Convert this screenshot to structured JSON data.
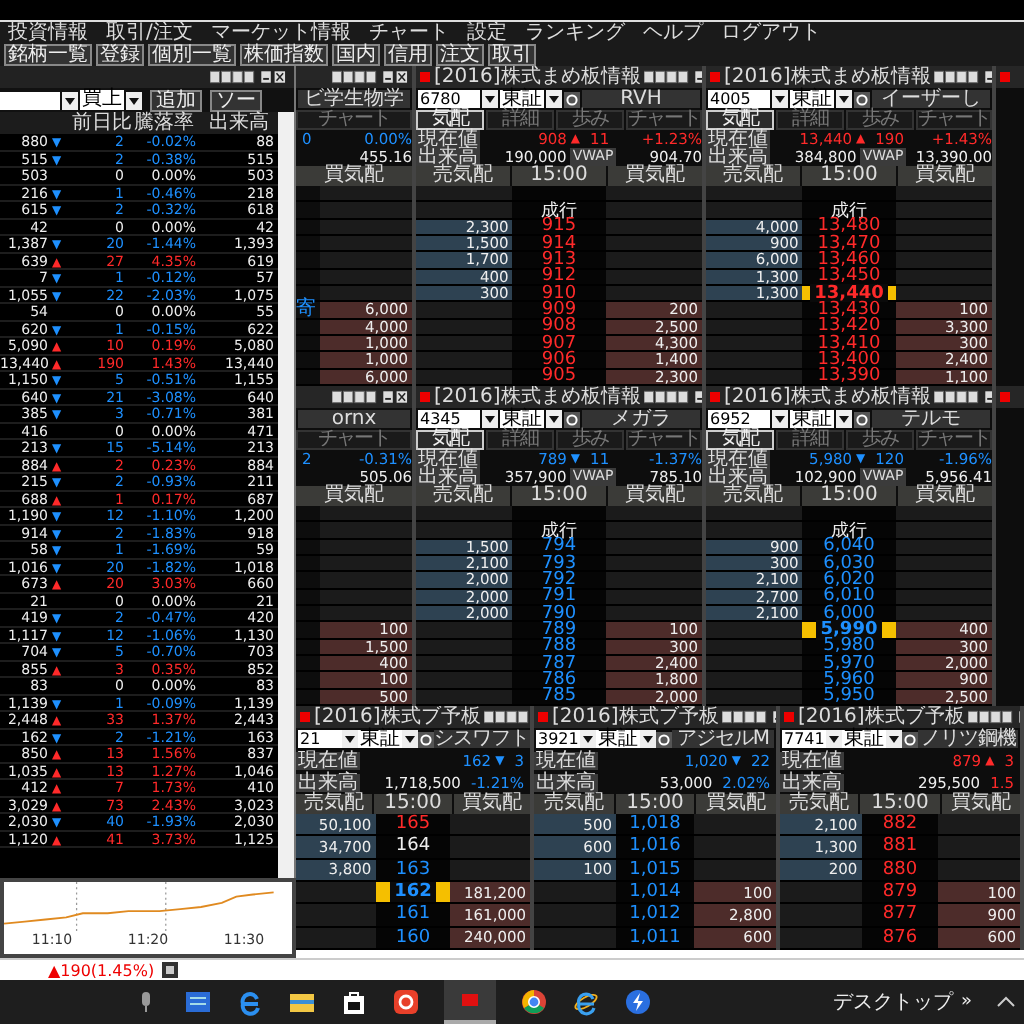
{
  "menu": [
    "投資情報",
    "取引/注文",
    "マーケット情報",
    "チャート",
    "設定",
    "ランキング",
    "ヘルプ",
    "ログアウト"
  ],
  "toolbar": [
    "銘柄一覧",
    "登録",
    "個別一覧",
    "株価指数",
    "国内",
    "信用",
    "注文",
    "取引"
  ],
  "list": {
    "market": "買上",
    "add_button": "追加",
    "sort_button": "ソー",
    "columns": [
      "前日比",
      "騰落率",
      "出来高"
    ],
    "rows": [
      {
        "price": "880",
        "color": "#1e90ff",
        "arrow": "▼",
        "change": "2",
        "pct": "-0.02%",
        "volume": "88"
      },
      {
        "price": "515",
        "color": "#1e90ff",
        "arrow": "▼",
        "change": "2",
        "pct": "-0.38%",
        "volume": "515"
      },
      {
        "price": "503",
        "color": "#eeeeee",
        "change": "0",
        "pct": "0.00%",
        "volume": "503"
      },
      {
        "price": "216",
        "color": "#1e90ff",
        "arrow": "▼",
        "change": "1",
        "pct": "-0.46%",
        "volume": "218"
      },
      {
        "price": "615",
        "color": "#1e90ff",
        "arrow": "▼",
        "change": "2",
        "pct": "-0.32%",
        "volume": "618"
      },
      {
        "price": "42",
        "color": "#eeeeee",
        "change": "0",
        "pct": "0.00%",
        "volume": "42"
      },
      {
        "price": "1,387",
        "color": "#1e90ff",
        "arrow": "▼",
        "change": "20",
        "pct": "-1.44%",
        "volume": "1,393"
      },
      {
        "price": "639",
        "color": "#ff2a2a",
        "arrow": "▲",
        "change": "27",
        "pct": "4.35%",
        "volume": "619"
      },
      {
        "price": "7",
        "color": "#1e90ff",
        "arrow": "▼",
        "change": "1",
        "pct": "-0.12%",
        "volume": "57"
      },
      {
        "price": "1,055",
        "color": "#1e90ff",
        "arrow": "▼",
        "change": "22",
        "pct": "-2.03%",
        "volume": "1,075"
      },
      {
        "price": "54",
        "color": "#eeeeee",
        "change": "0",
        "pct": "0.00%",
        "volume": "55"
      },
      {
        "price": "620",
        "color": "#1e90ff",
        "arrow": "▼",
        "change": "1",
        "pct": "-0.15%",
        "volume": "622"
      },
      {
        "price": "5,090",
        "color": "#ff2a2a",
        "arrow": "▲",
        "change": "10",
        "pct": "0.19%",
        "volume": "5,080"
      },
      {
        "price": "13,440",
        "color": "#ff2a2a",
        "arrow": "▲",
        "change": "190",
        "pct": "1.43%",
        "volume": "13,440"
      },
      {
        "price": "1,150",
        "color": "#1e90ff",
        "arrow": "▼",
        "change": "5",
        "pct": "-0.51%",
        "volume": "1,155"
      },
      {
        "price": "640",
        "color": "#1e90ff",
        "arrow": "▼",
        "change": "21",
        "pct": "-3.08%",
        "volume": "640"
      },
      {
        "price": "385",
        "color": "#1e90ff",
        "arrow": "▼",
        "change": "3",
        "pct": "-0.71%",
        "volume": "381"
      },
      {
        "price": "416",
        "color": "#eeeeee",
        "change": "0",
        "pct": "0.00%",
        "volume": "471"
      },
      {
        "price": "213",
        "color": "#1e90ff",
        "arrow": "▼",
        "change": "15",
        "pct": "-5.14%",
        "volume": "213"
      },
      {
        "price": "884",
        "color": "#ff2a2a",
        "arrow": "▲",
        "change": "2",
        "pct": "0.23%",
        "volume": "884"
      },
      {
        "price": "215",
        "color": "#1e90ff",
        "arrow": "▼",
        "change": "2",
        "pct": "-0.93%",
        "volume": "211"
      },
      {
        "price": "688",
        "color": "#ff2a2a",
        "arrow": "▲",
        "change": "1",
        "pct": "0.17%",
        "volume": "687"
      },
      {
        "price": "1,190",
        "color": "#1e90ff",
        "arrow": "▼",
        "change": "12",
        "pct": "-1.10%",
        "volume": "1,200"
      },
      {
        "price": "914",
        "color": "#1e90ff",
        "arrow": "▼",
        "change": "2",
        "pct": "-1.83%",
        "volume": "918"
      },
      {
        "price": "58",
        "color": "#1e90ff",
        "arrow": "▼",
        "change": "1",
        "pct": "-1.69%",
        "volume": "59"
      },
      {
        "price": "1,016",
        "color": "#1e90ff",
        "arrow": "▼",
        "change": "20",
        "pct": "-1.82%",
        "volume": "1,018"
      },
      {
        "price": "673",
        "color": "#ff2a2a",
        "arrow": "▲",
        "change": "20",
        "pct": "3.03%",
        "volume": "660"
      },
      {
        "price": "21",
        "color": "#eeeeee",
        "change": "0",
        "pct": "0.00%",
        "volume": "21"
      },
      {
        "price": "419",
        "color": "#1e90ff",
        "arrow": "▼",
        "change": "2",
        "pct": "-0.47%",
        "volume": "420"
      },
      {
        "price": "1,117",
        "color": "#1e90ff",
        "arrow": "▼",
        "change": "12",
        "pct": "-1.06%",
        "volume": "1,130"
      },
      {
        "price": "704",
        "color": "#1e90ff",
        "arrow": "▼",
        "change": "5",
        "pct": "-0.70%",
        "volume": "703"
      },
      {
        "price": "855",
        "color": "#ff2a2a",
        "arrow": "▲",
        "change": "3",
        "pct": "0.35%",
        "volume": "852"
      },
      {
        "price": "83",
        "color": "#eeeeee",
        "change": "0",
        "pct": "0.00%",
        "volume": "83"
      },
      {
        "price": "1,139",
        "color": "#1e90ff",
        "arrow": "▼",
        "change": "1",
        "pct": "-0.09%",
        "volume": "1,139"
      },
      {
        "price": "2,448",
        "color": "#ff2a2a",
        "arrow": "▲",
        "change": "33",
        "pct": "1.37%",
        "volume": "2,443"
      },
      {
        "price": "162",
        "color": "#1e90ff",
        "arrow": "▼",
        "change": "2",
        "pct": "-1.21%",
        "volume": "163"
      },
      {
        "price": "850",
        "color": "#ff2a2a",
        "arrow": "▲",
        "change": "13",
        "pct": "1.56%",
        "volume": "837"
      },
      {
        "price": "1,035",
        "color": "#ff2a2a",
        "arrow": "▲",
        "change": "13",
        "pct": "1.27%",
        "volume": "1,046"
      },
      {
        "price": "412",
        "color": "#ff2a2a",
        "arrow": "▲",
        "change": "7",
        "pct": "1.73%",
        "volume": "410"
      },
      {
        "price": "3,029",
        "color": "#ff2a2a",
        "arrow": "▲",
        "change": "73",
        "pct": "2.43%",
        "volume": "3,023"
      },
      {
        "price": "2,030",
        "color": "#1e90ff",
        "arrow": "▼",
        "change": "40",
        "pct": "-1.93%",
        "volume": "2,030"
      },
      {
        "price": "1,120",
        "color": "#ff2a2a",
        "arrow": "▲",
        "change": "41",
        "pct": "3.73%",
        "volume": "1,125"
      }
    ]
  },
  "chart": {
    "xlabels": [
      "11:10",
      "11:20",
      "11:30"
    ]
  },
  "board_rows": [
    [
      {
        "kind": "buy-only",
        "name": "ビ学生物学",
        "tab": "チャート",
        "change": "0",
        "pct": "0.00%",
        "vwap": "455.16",
        "buy_header": "買気配",
        "ladder": [
          {
            "buy": "6,000",
            "tag": "寄"
          },
          {
            "buy": "4,000"
          },
          {
            "buy": "1,000"
          },
          {
            "buy": "1,000"
          },
          {
            "buy": "6,000"
          }
        ]
      },
      {
        "kind": "full",
        "title": "[2016]株式まめ板情報",
        "code": "6780",
        "market": "東証",
        "name": "RVH",
        "tabs": [
          {
            "label": "気配",
            "selected": true
          },
          {
            "label": "詳細",
            "selected": false
          },
          {
            "label": "歩み",
            "selected": false
          },
          {
            "label": "チャート",
            "selected": false
          }
        ],
        "price_label": "現在値",
        "price": "908",
        "color": "#ff2a2a",
        "arrow": "▲",
        "change": "11",
        "pct": "+1.23%",
        "volume_label": "出来高",
        "volume": "190,000",
        "vwap_label": "VWAP",
        "vwap": "904.70",
        "headers": [
          "売気配",
          "15:00",
          "買気配"
        ],
        "ladder": [
          {
            "current": false
          },
          {
            "price": "成行",
            "color": "#eeeeee",
            "current": false
          },
          {
            "sell": "2,300",
            "price": "915",
            "color": "#ff2a2a",
            "current": false
          },
          {
            "sell": "1,500",
            "price": "914",
            "color": "#ff2a2a",
            "current": false
          },
          {
            "sell": "1,700",
            "price": "913",
            "color": "#ff2a2a",
            "current": false
          },
          {
            "sell": "400",
            "price": "912",
            "color": "#ff2a2a",
            "current": false
          },
          {
            "sell": "300",
            "price": "910",
            "color": "#ff2a2a",
            "current": false
          },
          {
            "price": "909",
            "buy": "200",
            "color": "#ff2a2a",
            "current": false
          },
          {
            "price": "908",
            "buy": "2,500",
            "color": "#ff2a2a",
            "current": false
          },
          {
            "price": "907",
            "buy": "4,300",
            "color": "#ff2a2a",
            "current": false
          },
          {
            "price": "906",
            "buy": "1,400",
            "color": "#ff2a2a",
            "current": false
          },
          {
            "price": "905",
            "buy": "2,300",
            "color": "#ff2a2a",
            "current": false
          }
        ]
      },
      {
        "kind": "full",
        "title": "[2016]株式まめ板情報",
        "code": "4005",
        "market": "東証",
        "name": "イーザーし",
        "tabs": [
          {
            "label": "気配",
            "selected": true
          },
          {
            "label": "詳細",
            "selected": false
          },
          {
            "label": "歩み",
            "selected": false
          },
          {
            "label": "チャート",
            "selected": false
          }
        ],
        "price_label": "現在値",
        "price": "13,440",
        "color": "#ff2a2a",
        "arrow": "▲",
        "change": "190",
        "pct": "+1.43%",
        "volume_label": "出来高",
        "volume": "384,800",
        "vwap_label": "VWAP",
        "vwap": "13,390.00",
        "headers": [
          "売気配",
          "15:00",
          "買気配"
        ],
        "ladder": [
          {
            "current": false
          },
          {
            "price": "成行",
            "color": "#eeeeee",
            "current": false
          },
          {
            "sell": "4,000",
            "price": "13,480",
            "color": "#ff2a2a",
            "current": false
          },
          {
            "sell": "900",
            "price": "13,470",
            "color": "#ff2a2a",
            "current": false
          },
          {
            "sell": "6,000",
            "price": "13,460",
            "color": "#ff2a2a",
            "current": false
          },
          {
            "sell": "1,300",
            "price": "13,450",
            "color": "#ff2a2a",
            "current": false
          },
          {
            "sell": "1,300",
            "price": "13,440",
            "color": "#ff2a2a",
            "current": true
          },
          {
            "price": "13,430",
            "buy": "100",
            "color": "#ff2a2a",
            "current": false
          },
          {
            "price": "13,420",
            "buy": "3,300",
            "color": "#ff2a2a",
            "current": false
          },
          {
            "price": "13,410",
            "buy": "300",
            "color": "#ff2a2a",
            "current": false
          },
          {
            "price": "13,400",
            "buy": "2,400",
            "color": "#ff2a2a",
            "current": false
          },
          {
            "price": "13,390",
            "buy": "1,100",
            "color": "#ff2a2a",
            "current": false
          }
        ]
      },
      {
        "kind": "edge"
      }
    ],
    [
      {
        "kind": "buy-only",
        "name": "ornx",
        "tab": "チャート",
        "change": "2",
        "pct": "-0.31%",
        "vwap": "505.06",
        "buy_header": "買気配",
        "ladder": [
          {
            "buy": "100"
          },
          {
            "buy": "1,500"
          },
          {
            "buy": "400"
          },
          {
            "buy": "100"
          },
          {
            "buy": "500"
          }
        ]
      },
      {
        "kind": "full",
        "title": "[2016]株式まめ板情報",
        "code": "4345",
        "market": "東証",
        "name": "メガラ",
        "tabs": [
          {
            "label": "気配",
            "selected": true
          },
          {
            "label": "詳細",
            "selected": false
          },
          {
            "label": "歩み",
            "selected": false
          },
          {
            "label": "チャート",
            "selected": false
          }
        ],
        "price_label": "現在値",
        "price": "789",
        "color": "#1e90ff",
        "arrow": "▼",
        "change": "11",
        "pct": "-1.37%",
        "volume_label": "出来高",
        "volume": "357,900",
        "vwap_label": "VWAP",
        "vwap": "785.10",
        "headers": [
          "売気配",
          "15:00",
          "買気配"
        ],
        "ladder": [
          {
            "current": false
          },
          {
            "price": "成行",
            "color": "#eeeeee",
            "current": false
          },
          {
            "sell": "1,500",
            "price": "794",
            "color": "#1e90ff",
            "current": false
          },
          {
            "sell": "2,100",
            "price": "793",
            "color": "#1e90ff",
            "current": false
          },
          {
            "sell": "2,000",
            "price": "792",
            "color": "#1e90ff",
            "current": false
          },
          {
            "sell": "2,000",
            "price": "791",
            "color": "#1e90ff",
            "current": false
          },
          {
            "sell": "2,000",
            "price": "790",
            "color": "#1e90ff",
            "current": false
          },
          {
            "price": "789",
            "buy": "100",
            "color": "#1e90ff",
            "current": false
          },
          {
            "price": "788",
            "buy": "300",
            "color": "#1e90ff",
            "current": false
          },
          {
            "price": "787",
            "buy": "2,400",
            "color": "#1e90ff",
            "current": false
          },
          {
            "price": "786",
            "buy": "1,800",
            "color": "#1e90ff",
            "current": false
          },
          {
            "price": "785",
            "buy": "2,000",
            "color": "#1e90ff",
            "current": false
          }
        ]
      },
      {
        "kind": "full",
        "title": "[2016]株式まめ板情報",
        "code": "6952",
        "market": "東証",
        "name": "テルモ",
        "tabs": [
          {
            "label": "気配",
            "selected": true
          },
          {
            "label": "詳細",
            "selected": false
          },
          {
            "label": "歩み",
            "selected": false
          },
          {
            "label": "チャート",
            "selected": false
          }
        ],
        "price_label": "現在値",
        "price": "5,980",
        "color": "#1e90ff",
        "arrow": "▼",
        "change": "120",
        "pct": "-1.96%",
        "volume_label": "出来高",
        "volume": "102,900",
        "vwap_label": "VWAP",
        "vwap": "5,956.41",
        "headers": [
          "売気配",
          "15:00",
          "買気配"
        ],
        "ladder": [
          {
            "current": false
          },
          {
            "price": "成行",
            "color": "#eeeeee",
            "current": false
          },
          {
            "sell": "900",
            "price": "6,040",
            "color": "#1e90ff",
            "current": false
          },
          {
            "sell": "300",
            "price": "6,030",
            "color": "#1e90ff",
            "current": false
          },
          {
            "sell": "2,100",
            "price": "6,020",
            "color": "#1e90ff",
            "current": false
          },
          {
            "sell": "2,700",
            "price": "6,010",
            "color": "#1e90ff",
            "current": false
          },
          {
            "sell": "2,100",
            "price": "6,000",
            "color": "#1e90ff",
            "current": false
          },
          {
            "price": "5,990",
            "buy": "400",
            "color": "#1e90ff",
            "current": true
          },
          {
            "price": "5,980",
            "buy": "300",
            "color": "#1e90ff",
            "current": false
          },
          {
            "price": "5,970",
            "buy": "2,000",
            "color": "#1e90ff",
            "current": false
          },
          {
            "price": "5,960",
            "buy": "900",
            "color": "#1e90ff",
            "current": false
          },
          {
            "price": "5,950",
            "buy": "2,500",
            "color": "#1e90ff",
            "current": false
          }
        ]
      },
      {
        "kind": "edge"
      }
    ],
    [
      {
        "kind": "mini",
        "title": "[2016]株式ブ予板",
        "code": "21",
        "market": "東証",
        "name": "シスワフト",
        "price_label": "現在値",
        "price": "162",
        "color": "#1e90ff",
        "arrow": "▼",
        "change": "3",
        "volume_label": "出来高",
        "volume": "1,718,500",
        "pct": "-1.21%",
        "headers": [
          "売気配",
          "15:00",
          "買気配"
        ],
        "ladder": [
          {
            "sell": "50,100",
            "price": "165",
            "color": "#ff2a2a",
            "current": false
          },
          {
            "sell": "34,700",
            "price": "164",
            "color": "#eeeeee",
            "current": false
          },
          {
            "sell": "3,800",
            "price": "163",
            "color": "#1e90ff",
            "current": false
          },
          {
            "price": "162",
            "buy": "181,200",
            "color": "#1e90ff",
            "current": true
          },
          {
            "price": "161",
            "buy": "161,000",
            "color": "#1e90ff",
            "current": false
          },
          {
            "price": "160",
            "buy": "240,000",
            "color": "#1e90ff",
            "current": false
          }
        ]
      },
      {
        "kind": "mini",
        "title": "[2016]株式ブ予板",
        "code": "3921",
        "market": "東証",
        "name": "アジセルM",
        "price_label": "現在値",
        "price": "1,020",
        "color": "#1e90ff",
        "arrow": "▼",
        "change": "22",
        "volume_label": "出来高",
        "volume": "53,000",
        "pct": "2.02%",
        "headers": [
          "売気配",
          "15:00",
          "買気配"
        ],
        "ladder": [
          {
            "sell": "500",
            "price": "1,018",
            "color": "#1e90ff",
            "current": false
          },
          {
            "sell": "600",
            "price": "1,016",
            "color": "#1e90ff",
            "current": false
          },
          {
            "sell": "100",
            "price": "1,015",
            "color": "#1e90ff",
            "current": false
          },
          {
            "price": "1,014",
            "buy": "100",
            "color": "#1e90ff",
            "current": false
          },
          {
            "price": "1,012",
            "buy": "2,800",
            "color": "#1e90ff",
            "current": false
          },
          {
            "price": "1,011",
            "buy": "600",
            "color": "#1e90ff",
            "current": false
          }
        ]
      },
      {
        "kind": "mini",
        "title": "[2016]株式ブ予板",
        "code": "7741",
        "market": "東証",
        "name": "ノリツ鋼機",
        "price_label": "現在値",
        "price": "879",
        "color": "#ff2a2a",
        "arrow": "▲",
        "change": "3",
        "volume_label": "出来高",
        "volume": "295,500",
        "pct": "1.5",
        "headers": [
          "売気配",
          "15:00",
          "買気配"
        ],
        "ladder": [
          {
            "sell": "2,100",
            "price": "882",
            "color": "#ff2a2a",
            "current": false
          },
          {
            "sell": "1,300",
            "price": "881",
            "color": "#ff2a2a",
            "current": false
          },
          {
            "sell": "200",
            "price": "880",
            "color": "#ff2a2a",
            "current": false
          },
          {
            "price": "879",
            "buy": "100",
            "color": "#ff2a2a",
            "current": false
          },
          {
            "price": "877",
            "buy": "900",
            "color": "#ff2a2a",
            "current": false
          },
          {
            "price": "876",
            "buy": "600",
            "color": "#ff2a2a",
            "current": false
          }
        ]
      }
    ]
  ],
  "status": {
    "index_change": "▲190(1.45%)"
  },
  "taskbar": {
    "desktop_label": "デスクトップ",
    "overflow": "»"
  }
}
